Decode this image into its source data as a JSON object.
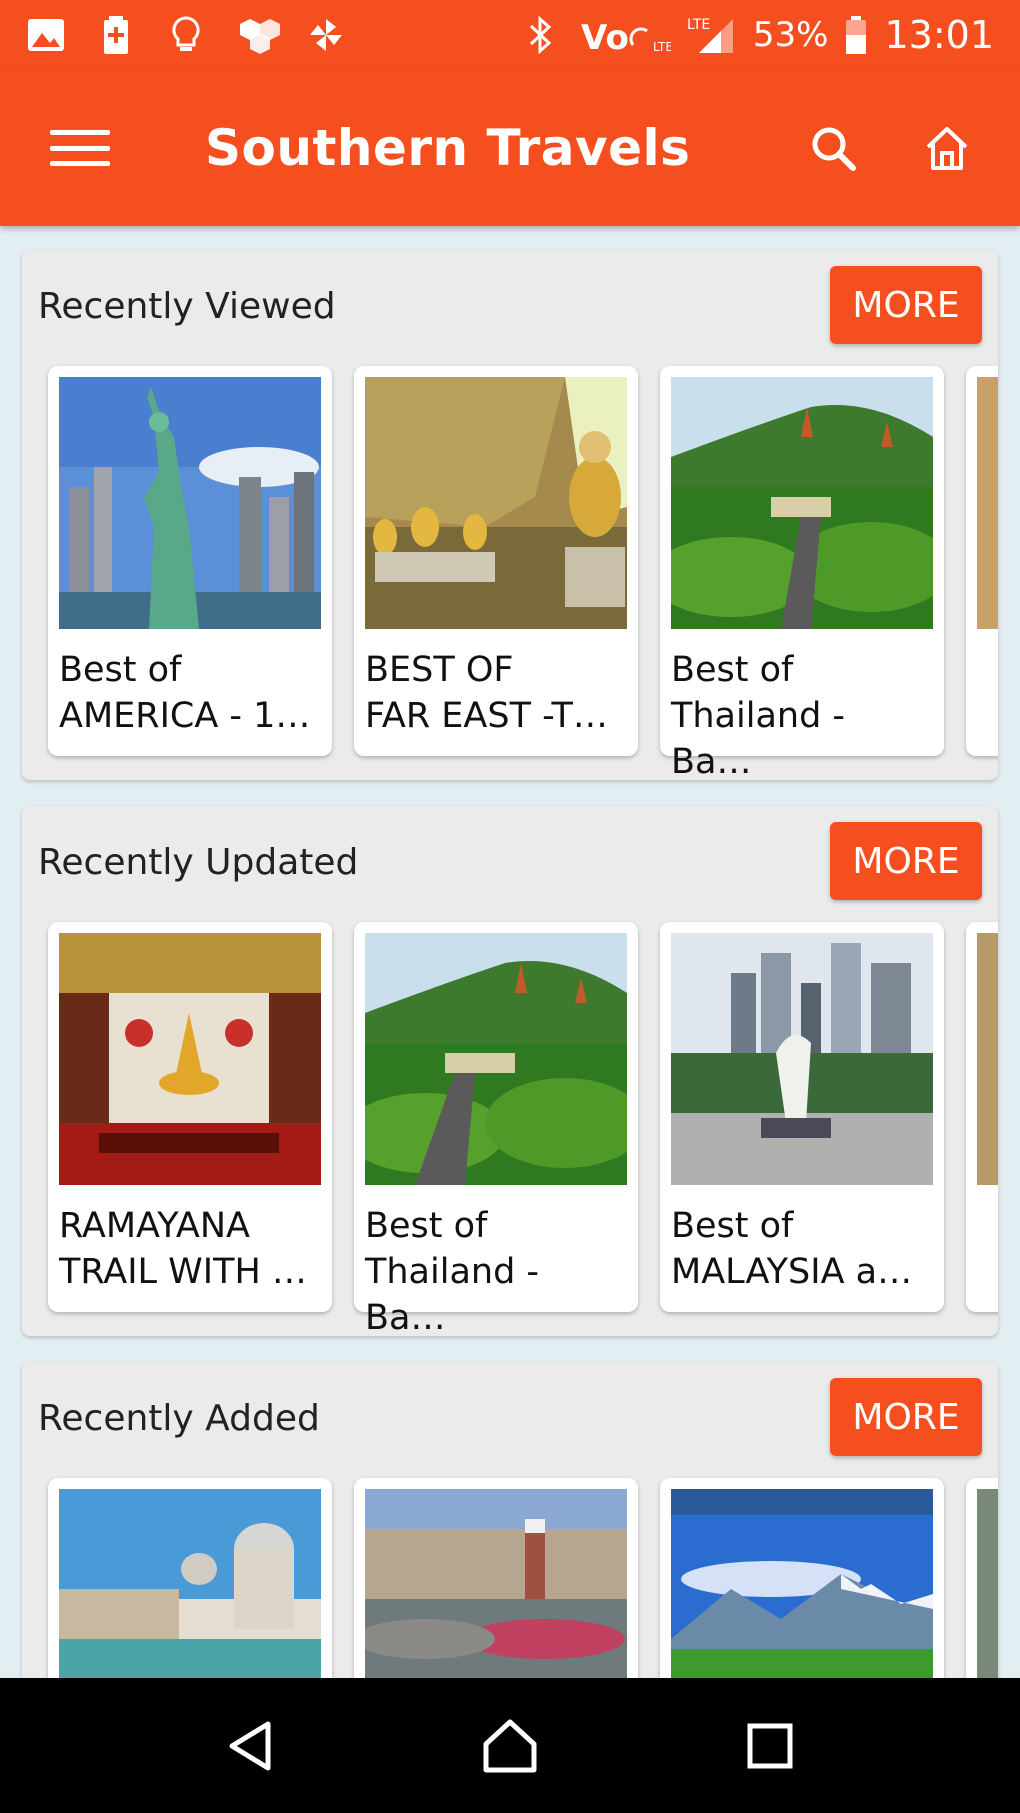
{
  "status_bar": {
    "battery_percent": "53%",
    "time": "13:01",
    "icons": [
      "image-icon",
      "battery-saver-icon",
      "lightbulb-icon",
      "cluster-icon",
      "pinwheel-icon",
      "bluetooth-icon",
      "volte-icon",
      "lte-signal-icon",
      "battery-icon"
    ]
  },
  "app_bar": {
    "title": "Southern Travels",
    "icons": [
      "menu-icon",
      "search-icon",
      "home-icon"
    ]
  },
  "sections": [
    {
      "title": "Recently Viewed",
      "more_label": "MORE",
      "cards": [
        {
          "title": "Best of\nAMERICA - 1…"
        },
        {
          "title": "BEST OF\nFAR EAST -T…"
        },
        {
          "title": "Best of\nThailand - Ba…"
        }
      ]
    },
    {
      "title": "Recently Updated",
      "more_label": "MORE",
      "cards": [
        {
          "title": "RAMAYANA\nTRAIL WITH …"
        },
        {
          "title": "Best of\nThailand - Ba…"
        },
        {
          "title": "Best of\nMALAYSIA a…"
        }
      ]
    },
    {
      "title": "Recently Added",
      "more_label": "MORE",
      "cards": [
        {
          "title": ""
        },
        {
          "title": ""
        },
        {
          "title": ""
        }
      ]
    }
  ],
  "nav_bar": {
    "icons": [
      "back-icon",
      "home-nav-icon",
      "recents-icon"
    ]
  },
  "colors": {
    "accent": "#f54f1f",
    "background": "#e3eef3",
    "section_bg": "#ebebeb"
  }
}
